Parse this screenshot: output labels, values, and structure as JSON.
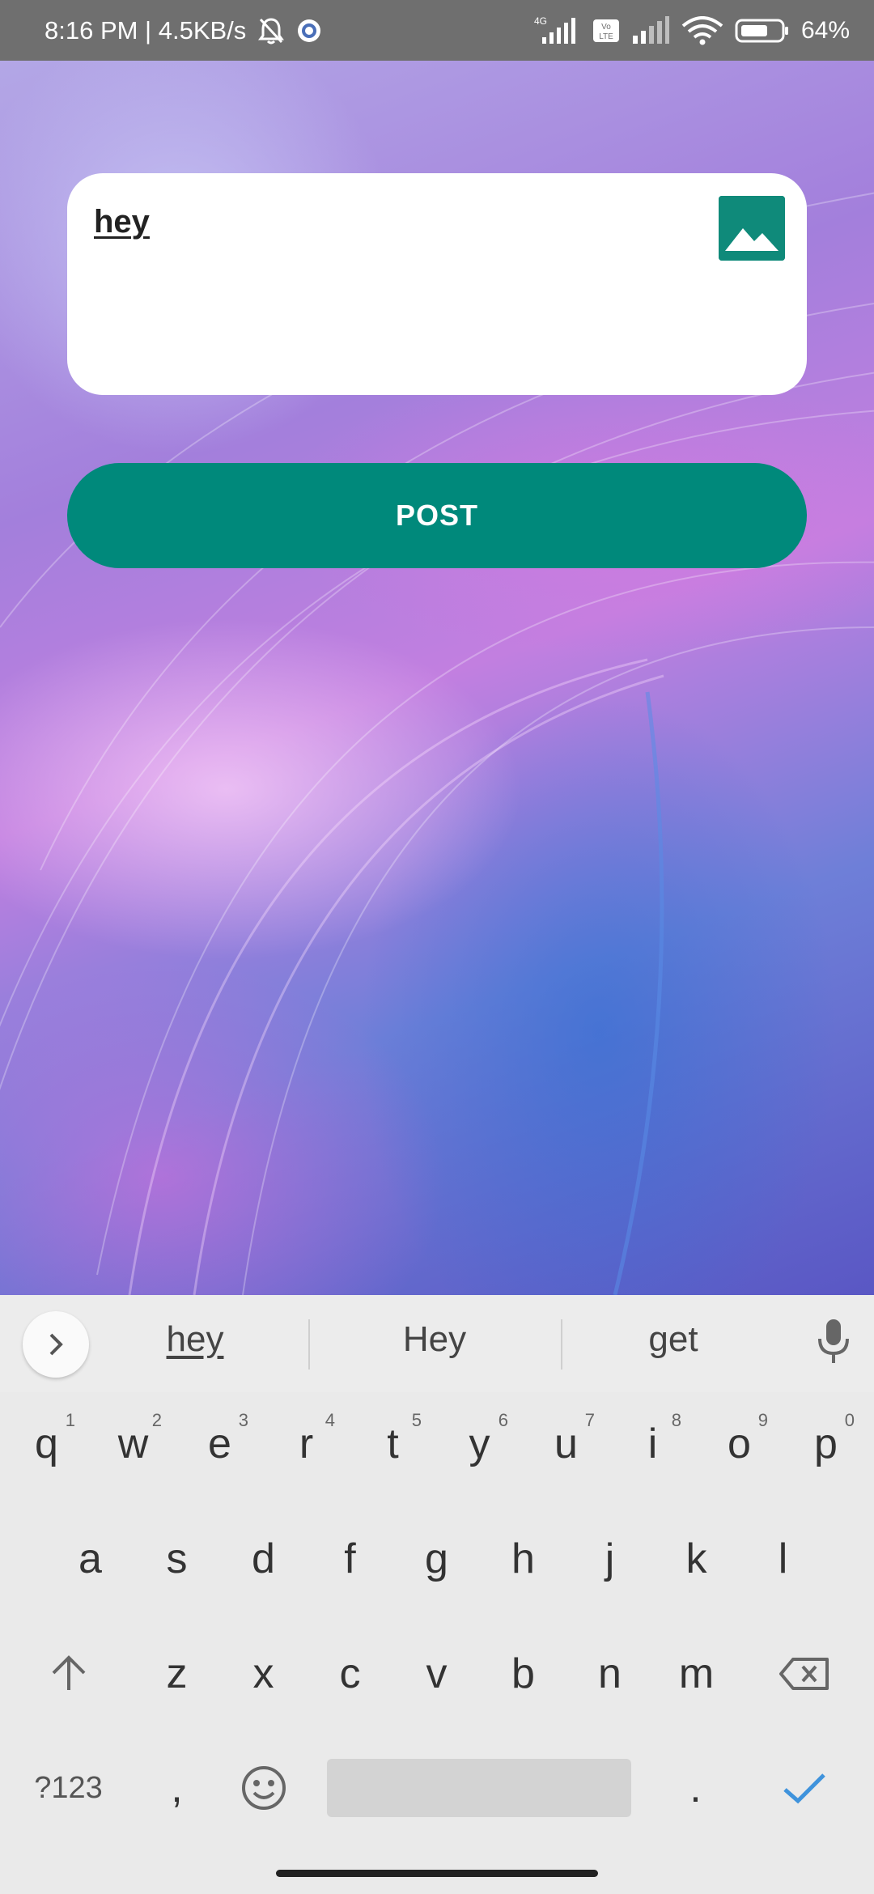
{
  "status_bar": {
    "time_speed": "8:16 PM | 4.5KB/s",
    "network_label": "4G",
    "volte_label": "Vo LTE",
    "battery_pct": "64%"
  },
  "post": {
    "text": "hey",
    "image_icon": "image-icon",
    "button_label": "POST",
    "accent_color": "#00897b"
  },
  "keyboard": {
    "suggestions": [
      "hey",
      "Hey",
      "get"
    ],
    "row1": [
      {
        "key": "q",
        "hint": "1"
      },
      {
        "key": "w",
        "hint": "2"
      },
      {
        "key": "e",
        "hint": "3"
      },
      {
        "key": "r",
        "hint": "4"
      },
      {
        "key": "t",
        "hint": "5"
      },
      {
        "key": "y",
        "hint": "6"
      },
      {
        "key": "u",
        "hint": "7"
      },
      {
        "key": "i",
        "hint": "8"
      },
      {
        "key": "o",
        "hint": "9"
      },
      {
        "key": "p",
        "hint": "0"
      }
    ],
    "row2": [
      "a",
      "s",
      "d",
      "f",
      "g",
      "h",
      "j",
      "k",
      "l"
    ],
    "row3": [
      "z",
      "x",
      "c",
      "v",
      "b",
      "n",
      "m"
    ],
    "symbols_label": "?123",
    "comma": ",",
    "period": "."
  }
}
